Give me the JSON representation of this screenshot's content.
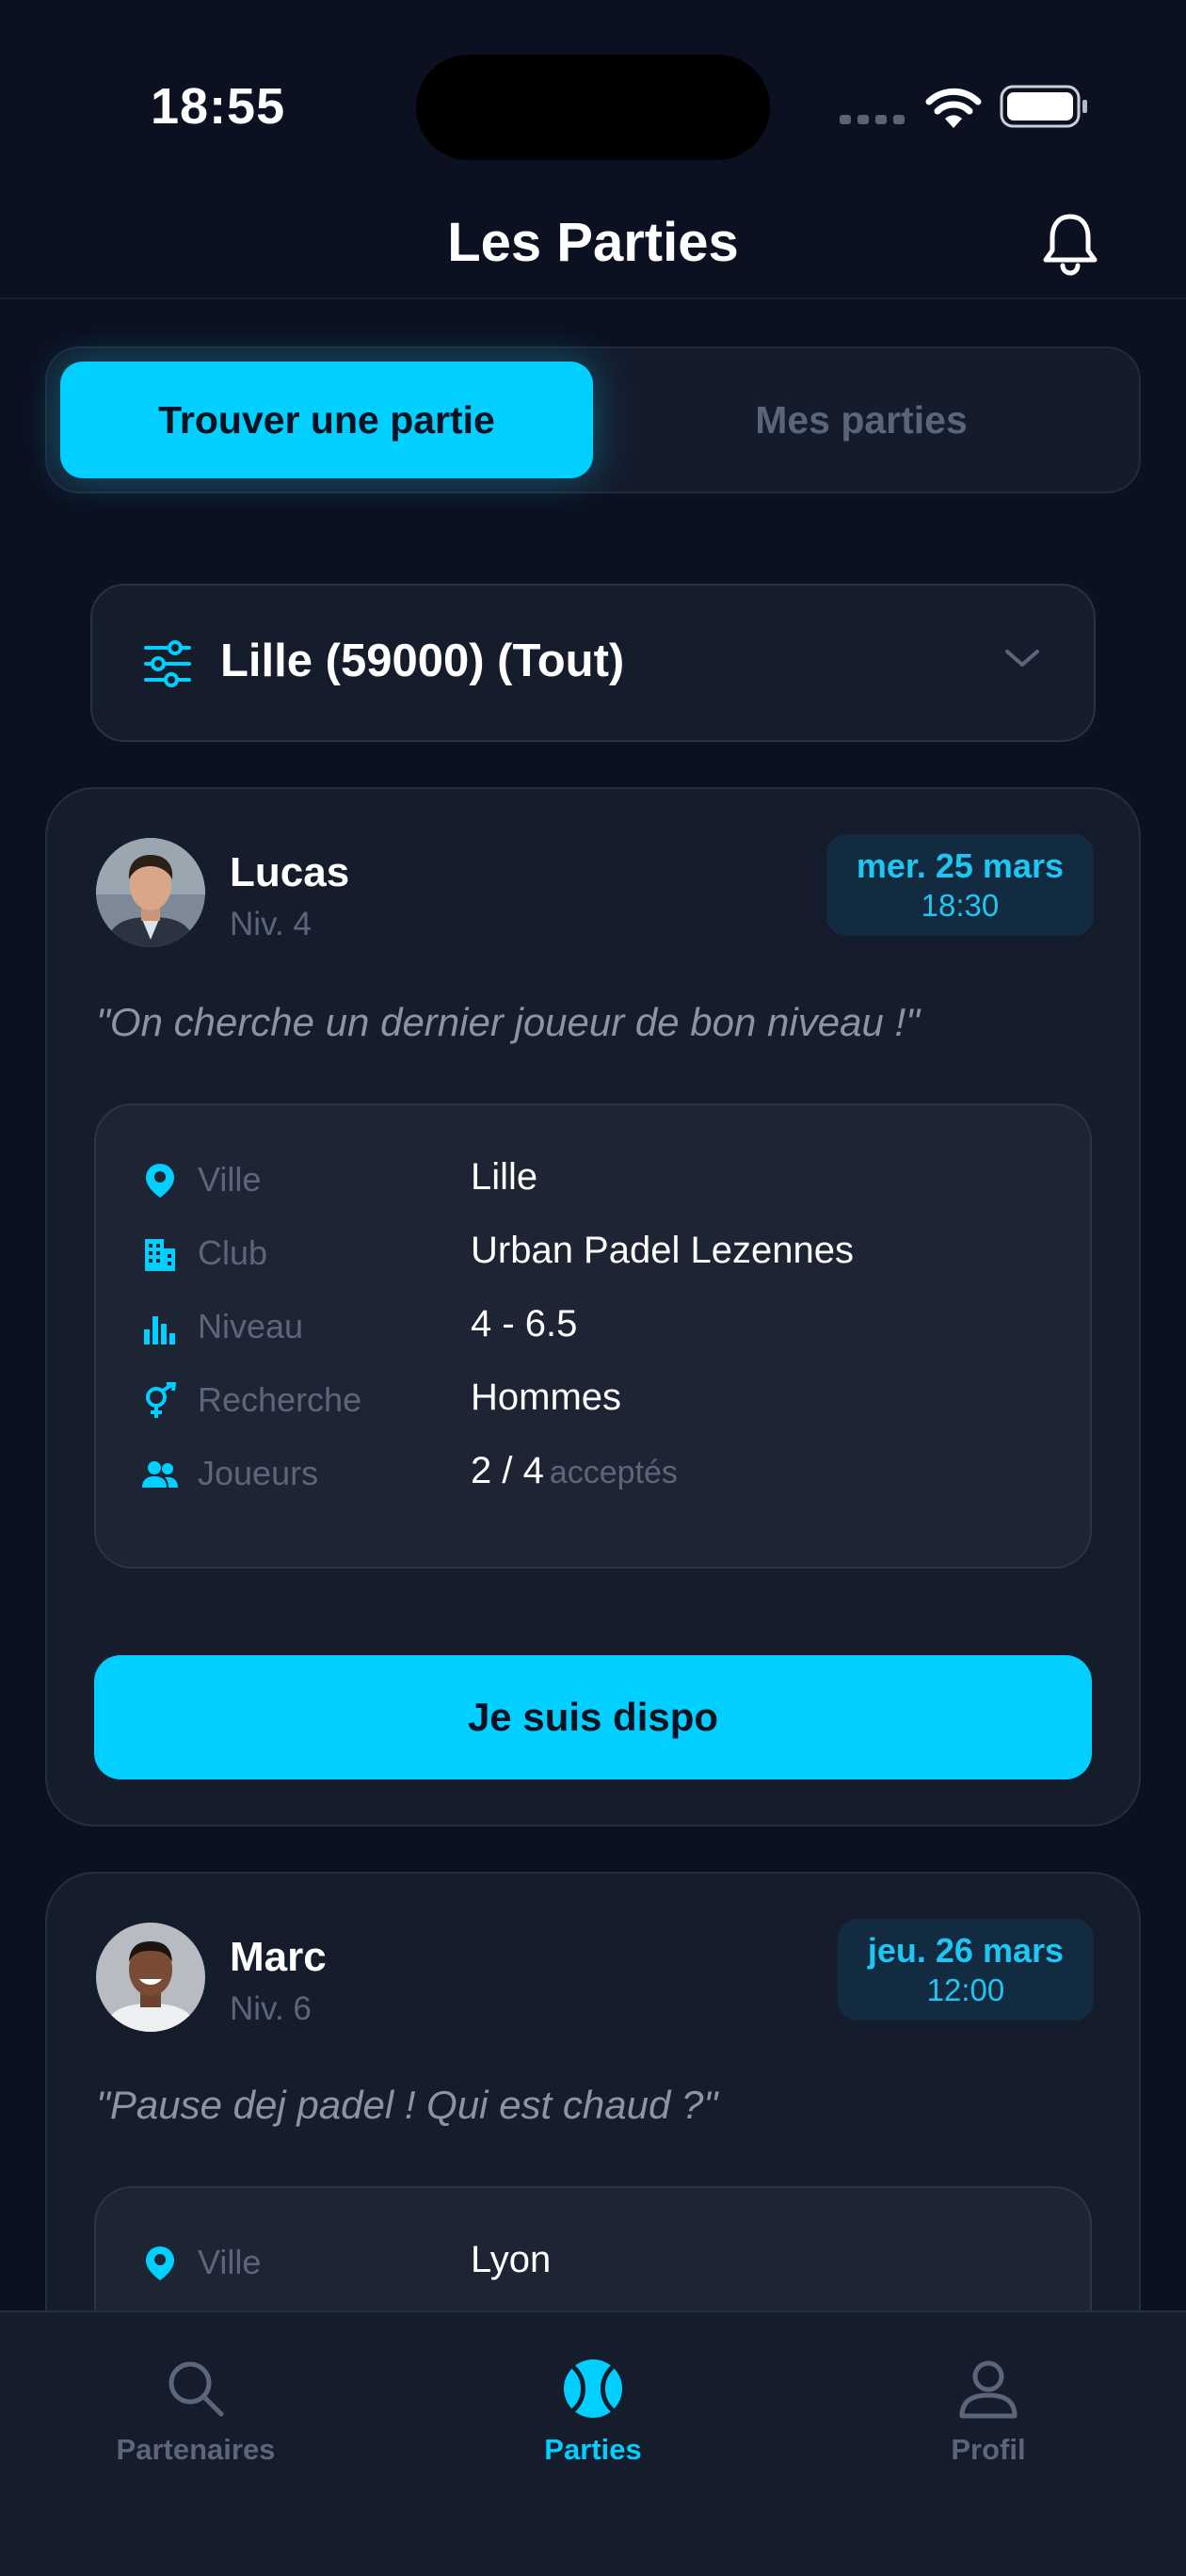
{
  "status_bar": {
    "time": "18:55"
  },
  "header": {
    "title": "Les Parties"
  },
  "segmented": {
    "active_label": "Trouver une partie",
    "inactive_label": "Mes parties"
  },
  "filter": {
    "label": "Lille (59000) (Tout)"
  },
  "colors": {
    "accent": "#00cfff",
    "background": "#0b1120",
    "card": "#151d2d"
  },
  "cards": [
    {
      "name": "Lucas",
      "level": "Niv. 4",
      "date": "mer. 25 mars",
      "time": "18:30",
      "quote": "\"On cherche un dernier joueur de bon niveau !\"",
      "details": {
        "ville_label": "Ville",
        "ville": "Lille",
        "club_label": "Club",
        "club": "Urban Padel Lezennes",
        "niveau_label": "Niveau",
        "niveau": "4 - 6.5",
        "recherche_label": "Recherche",
        "recherche": "Hommes",
        "joueurs_label": "Joueurs",
        "joueurs": "2 / 4",
        "joueurs_suffix": "acceptés"
      },
      "cta": "Je suis dispo"
    },
    {
      "name": "Marc",
      "level": "Niv. 6",
      "date": "jeu. 26 mars",
      "time": "12:00",
      "quote": "\"Pause dej padel ! Qui est chaud ?\"",
      "details": {
        "ville_label": "Ville",
        "ville": "Lyon"
      }
    }
  ],
  "tab_bar": {
    "items": [
      {
        "label": "Partenaires",
        "icon": "search-icon"
      },
      {
        "label": "Parties",
        "icon": "padel-ball-icon",
        "active": true
      },
      {
        "label": "Profil",
        "icon": "person-icon"
      }
    ]
  }
}
